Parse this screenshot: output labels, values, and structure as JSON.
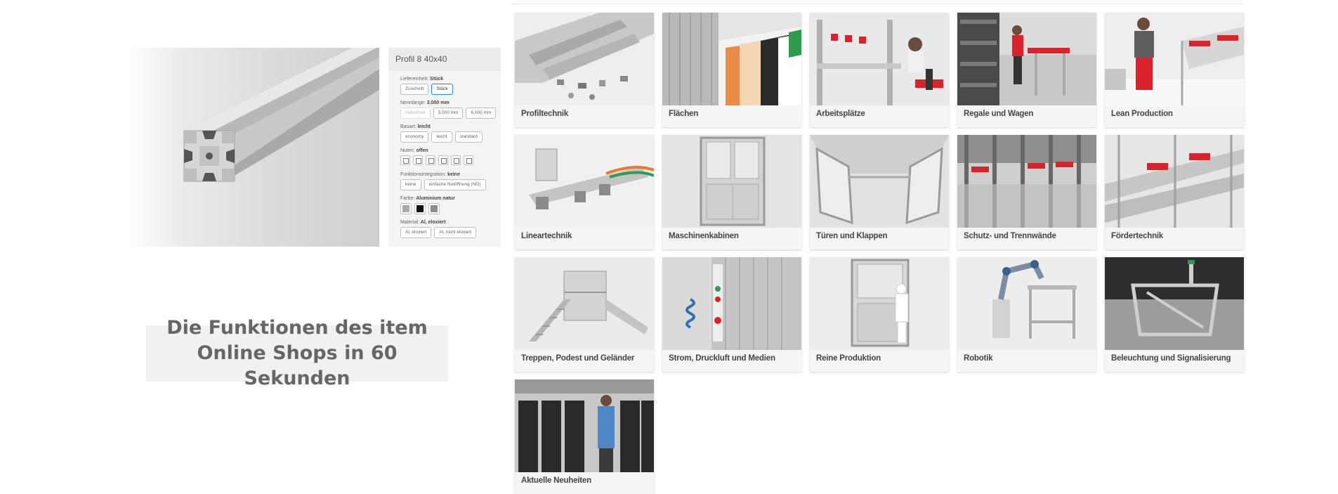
{
  "configurator": {
    "title": "Profil 8 40x40",
    "groups": [
      {
        "label": "Liefereinheit:",
        "value": "Stück",
        "options": [
          "Zuschnitt",
          "Stück"
        ],
        "active": 1
      },
      {
        "label": "Nennlänge:",
        "value": "3.000 mm",
        "options": [
          "individuell",
          "3.000 mm",
          "6.000 mm"
        ],
        "active": -1,
        "disabled": 0
      },
      {
        "label": "Bauart:",
        "value": "leicht",
        "options": [
          "economy",
          "leicht",
          "standard"
        ],
        "active": -1
      },
      {
        "label": "Nuten:",
        "value": "offen"
      },
      {
        "label": "Funktionsintegration:",
        "value": "keine",
        "options": [
          "keine",
          "einfache Nutöffnung (NO)"
        ],
        "active": -1
      },
      {
        "label": "Farbe:",
        "value": "Aluminium natur"
      },
      {
        "label": "Material:",
        "value": "Al, eloxiert",
        "options": [
          "Al, eloxiert",
          "Al, nicht eloxiert"
        ],
        "active": -1
      }
    ],
    "swatch_colors": [
      "#a9a9a9",
      "#111111",
      "#8c8c8c"
    ]
  },
  "video_caption": "Die Funktionen des item Online Shops in 60 Sekunden",
  "categories": [
    "Profiltechnik",
    "Flächen",
    "Arbeitsplätze",
    "Regale und Wagen",
    "Lean Production",
    "Lineartechnik",
    "Maschinenkabinen",
    "Türen und Klappen",
    "Schutz- und Trennwände",
    "Fördertechnik",
    "Treppen, Podest und Geländer",
    "Strom, Druckluft und Medien",
    "Reine Produktion",
    "Robotik",
    "Beleuchtung und Signalisierung",
    "Aktuelle Neuheiten"
  ],
  "colors": {
    "accent": "#1d8cc9",
    "card_bg": "#f5f5f5",
    "red": "#d8232a"
  }
}
